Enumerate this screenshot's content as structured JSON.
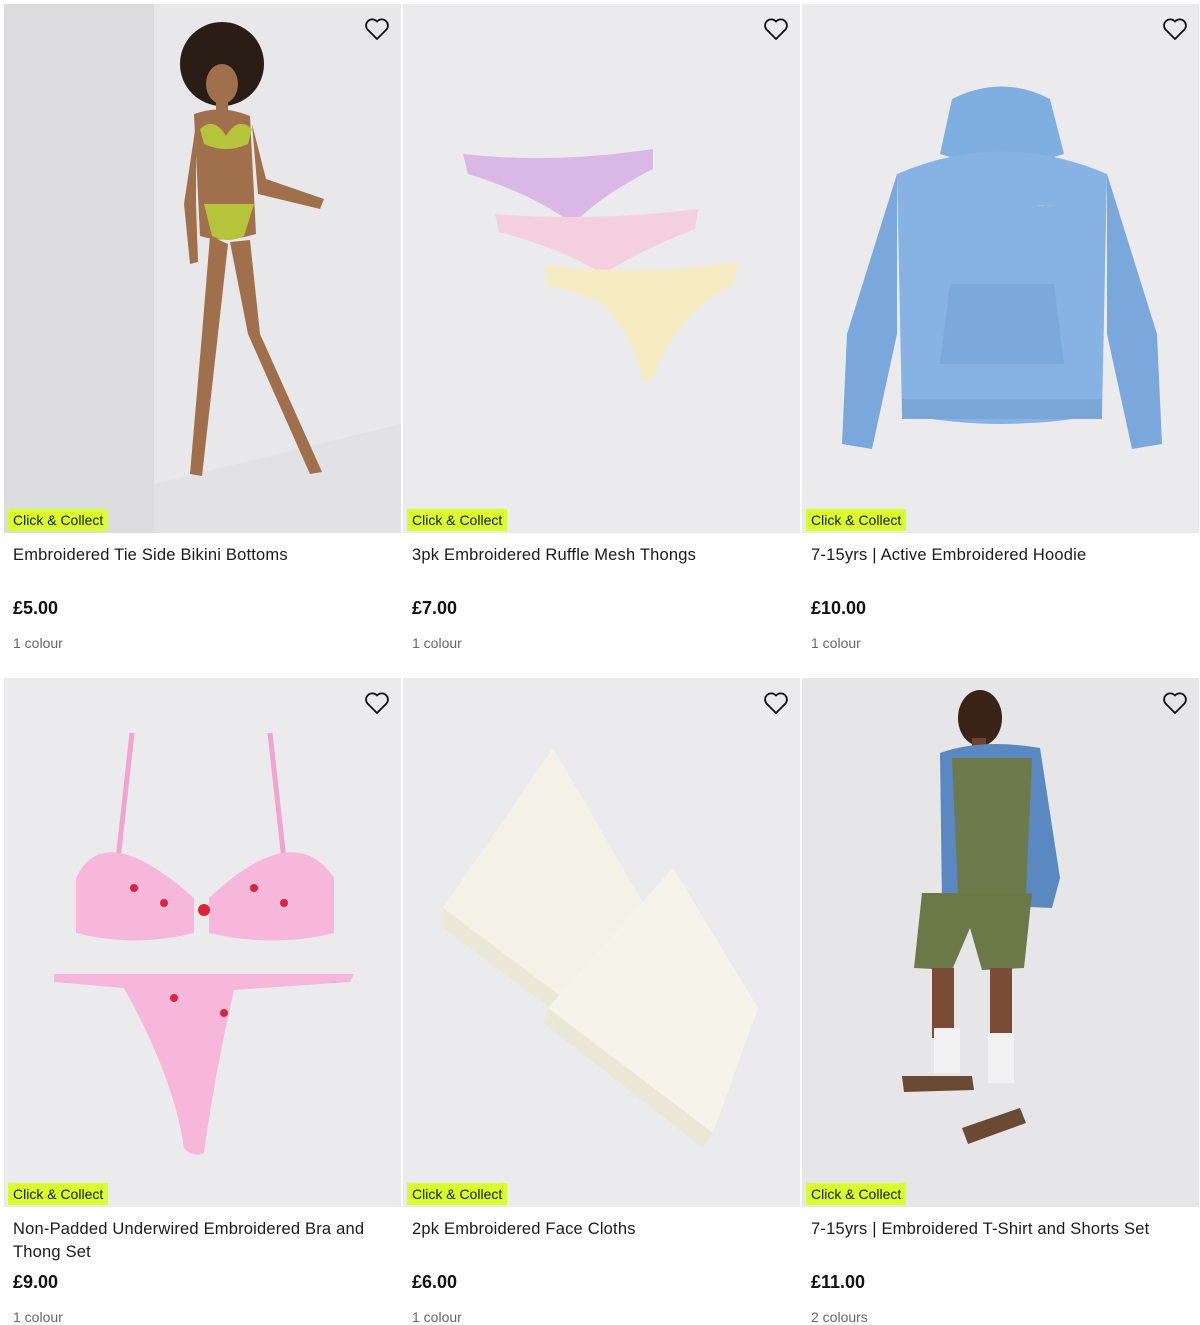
{
  "products": [
    {
      "title": "Embroidered Tie Side Bikini Bottoms",
      "price": "£5.00",
      "colours": "1 colour",
      "badge": "Click & Collect",
      "image": "model-bikini"
    },
    {
      "title": "3pk Embroidered Ruffle Mesh Thongs",
      "price": "£7.00",
      "colours": "1 colour",
      "badge": "Click & Collect",
      "image": "thongs-pack"
    },
    {
      "title": "7-15yrs | Active Embroidered Hoodie",
      "price": "£10.00",
      "colours": "1 colour",
      "badge": "Click & Collect",
      "image": "blue-hoodie"
    },
    {
      "title": "Non-Padded Underwired Embroidered Bra and Thong Set",
      "price": "£9.00",
      "colours": "1 colour",
      "badge": "Click & Collect",
      "image": "pink-bra-set"
    },
    {
      "title": "2pk Embroidered Face Cloths",
      "price": "£6.00",
      "colours": "1 colour",
      "badge": "Click & Collect",
      "image": "face-cloths"
    },
    {
      "title": "7-15yrs | Embroidered T-Shirt and Shorts Set",
      "price": "£11.00",
      "colours": "2 colours",
      "badge": "Click & Collect",
      "image": "kid-tshirt-shorts"
    }
  ],
  "colors": {
    "badge_bg": "#d9ff2e",
    "image_bg": "#e9e9eb"
  },
  "icons": {
    "wishlist": "heart-outline-icon"
  }
}
